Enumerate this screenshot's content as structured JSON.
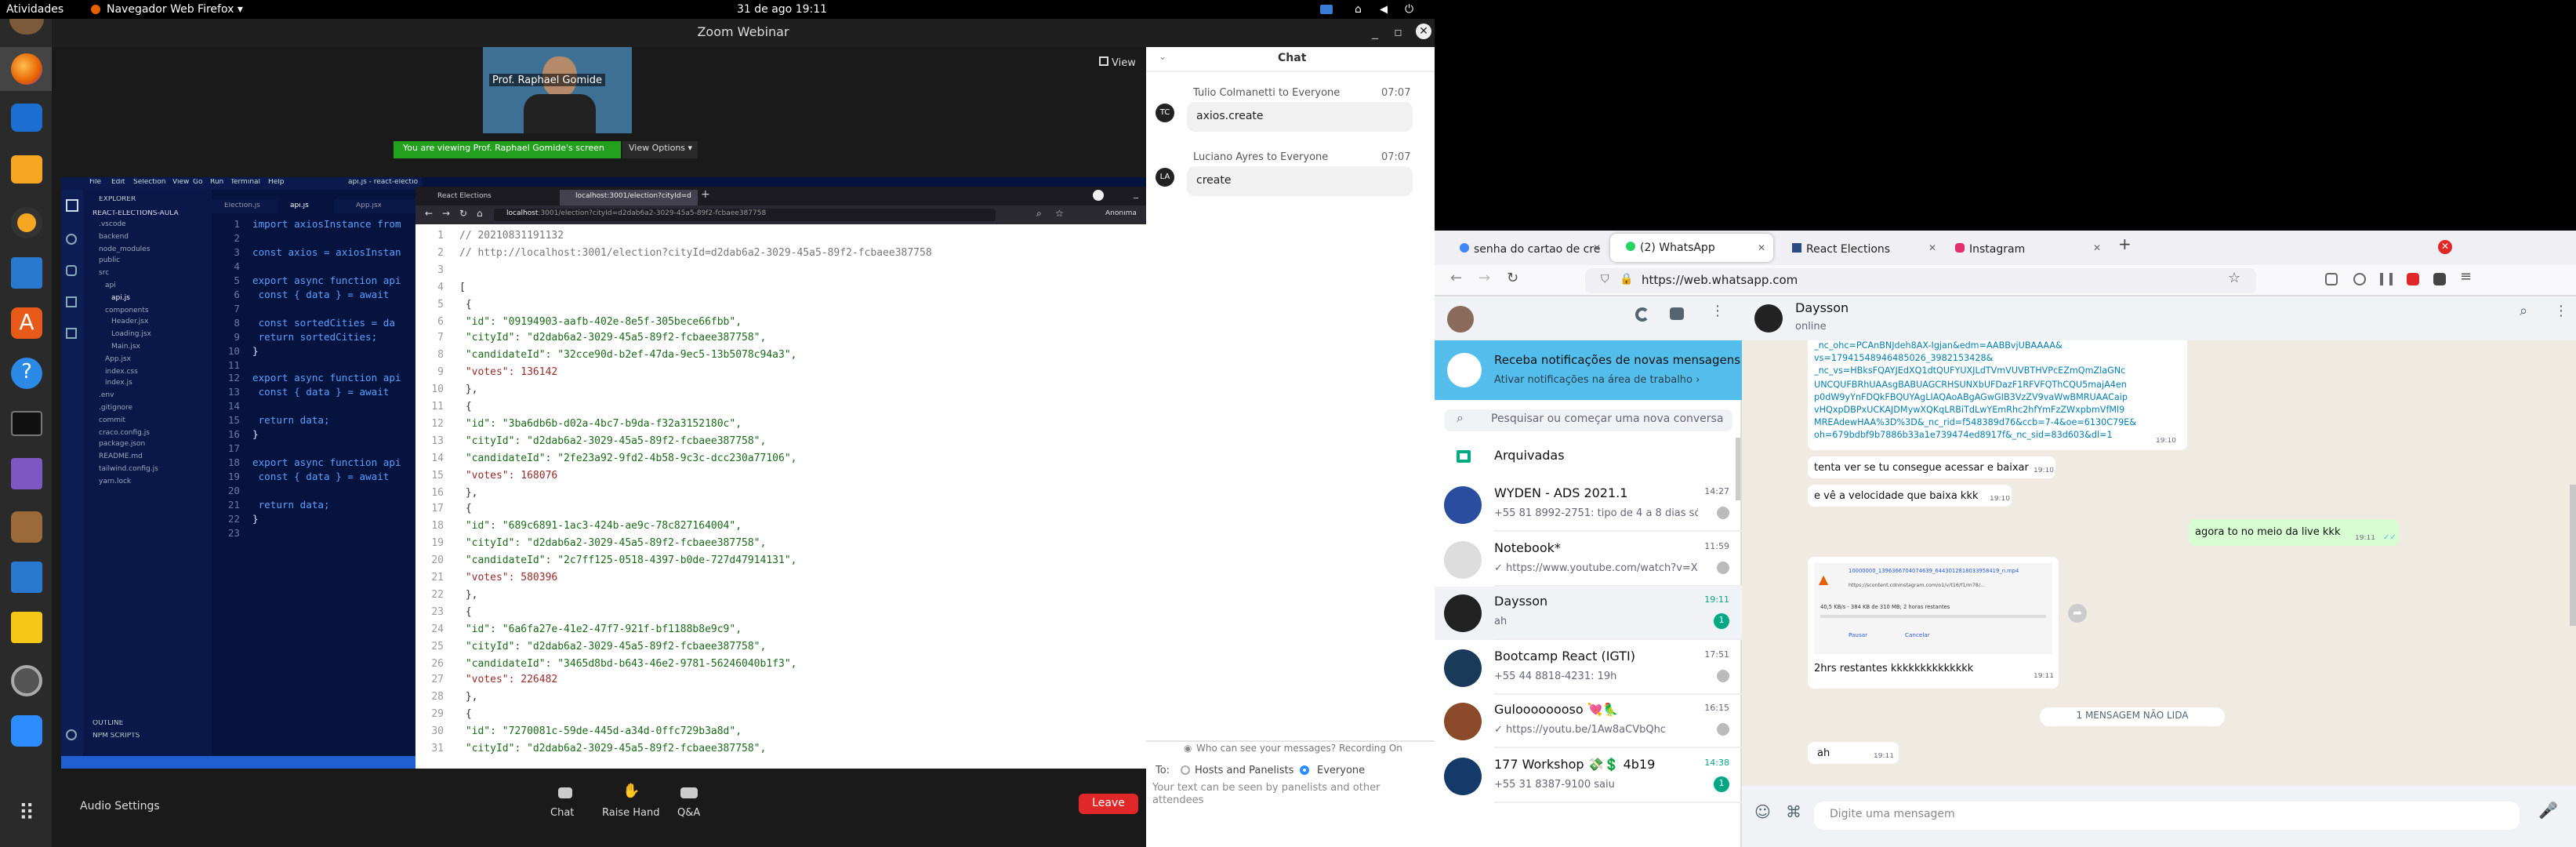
{
  "topbar": {
    "activities": "Atividades",
    "app": "Navegador Web Firefox ▾",
    "clock": "31 de ago  19:11"
  },
  "zoom": {
    "title": "Zoom Webinar",
    "view_label": "View",
    "speaker_name": "Prof. Raphael Gomide",
    "viewing_banner": "You are viewing Prof. Raphael Gomide's screen",
    "view_options": "View Options ▾",
    "audio_settings": "Audio Settings",
    "chat_btn": "Chat",
    "raise_hand_btn": "Raise Hand",
    "qa_btn": "Q&A",
    "leave_btn": "Leave"
  },
  "chat": {
    "title": "Chat",
    "messages": [
      {
        "avatar": "TC",
        "from": "Tulio Colmanetti to Everyone",
        "time": "07:07",
        "text": "axios.create"
      },
      {
        "avatar": "LA",
        "from": "Luciano Ayres to Everyone",
        "time": "07:07",
        "text": "create"
      }
    ],
    "who_can_see": "Who can see your messages? Recording On",
    "to_label": "To:",
    "opt_hosts": "Hosts and Panelists",
    "opt_everyone": "Everyone",
    "placeholder": "Your text can be seen by panelists and other attendees"
  },
  "vscode": {
    "menu": [
      "File",
      "Edit",
      "Selection",
      "View",
      "Go",
      "Run",
      "Terminal",
      "Help"
    ],
    "title": "api.js - react-electio",
    "tabs": [
      "Election.js",
      "api.js",
      "App.jsx"
    ],
    "explorer_title": "EXPLORER",
    "project": "REACT-ELECTIONS-AULA",
    "tree": [
      ".vscode",
      "backend",
      "node_modules",
      "public",
      "src",
      "api",
      "api.js",
      "components",
      "Header.jsx",
      "Loading.jsx",
      "Main.jsx",
      "App.jsx",
      "index.css",
      "index.js",
      ".env",
      ".gitignore",
      "commit",
      "craco.config.js",
      "package.json",
      "README.md",
      "tailwind.config.js",
      "yarn.lock"
    ],
    "outline": "OUTLINE",
    "npm_scripts": "NPM SCRIPTS",
    "code_lines": [
      "import axiosInstance from",
      "",
      "const axios = axiosInstan",
      "",
      "export async function api",
      "  const { data } = await",
      "",
      "  const sortedCities = da",
      "  return sortedCities;",
      "}",
      "",
      "export async function api",
      "  const { data } = await",
      "",
      "  return data;",
      "}",
      "",
      "export async function api",
      "  const { data } = await",
      "",
      "  return data;",
      "}",
      ""
    ]
  },
  "browser_left": {
    "tabs": [
      "React Elections",
      "localhost:3001/election?cityId=d"
    ],
    "url_host": "localhost",
    "url_rest": ":3001/election?cityId=d2dab6a2-3029-45a5-89f2-fcbaee387758",
    "profile": "Anônima",
    "json_lines": [
      "// 20210831191132",
      "// http://localhost:3001/election?cityId=d2dab6a2-3029-45a5-89f2-fcbaee387758",
      "",
      "[",
      "  {",
      "    \"id\": \"09194903-aafb-402e-8e5f-305bece66fbb\",",
      "    \"cityId\": \"d2dab6a2-3029-45a5-89f2-fcbaee387758\",",
      "    \"candidateId\": \"32cce90d-b2ef-47da-9ec5-13b5078c94a3\",",
      "    \"votes\": 136142",
      "  },",
      "  {",
      "    \"id\": \"3ba6db6b-d02a-4bc7-b9da-f32a3152180c\",",
      "    \"cityId\": \"d2dab6a2-3029-45a5-89f2-fcbaee387758\",",
      "    \"candidateId\": \"2fe23a92-9fd2-4b58-9c3c-dcc230a77106\",",
      "    \"votes\": 168076",
      "  },",
      "  {",
      "    \"id\": \"689c6891-1ac3-424b-ae9c-78c827164004\",",
      "    \"cityId\": \"d2dab6a2-3029-45a5-89f2-fcbaee387758\",",
      "    \"candidateId\": \"2c7ff125-0518-4397-b0de-727d47914131\",",
      "    \"votes\": 580396",
      "  },",
      "  {",
      "    \"id\": \"6a6fa27e-41e2-47f7-921f-bf1188b8e9c9\",",
      "    \"cityId\": \"d2dab6a2-3029-45a5-89f2-fcbaee387758\",",
      "    \"candidateId\": \"3465d8bd-b643-46e2-9781-56246040b1f3\",",
      "    \"votes\": 226482",
      "  },",
      "  {",
      "    \"id\": \"7270081c-59de-445d-a34d-0ffc729b3a8d\",",
      "    \"cityId\": \"d2dab6a2-3029-45a5-89f2-fcbaee387758\","
    ]
  },
  "firefox": {
    "tabs": [
      "senha do cartao de credi",
      "(2) WhatsApp",
      "React Elections",
      "Instagram"
    ],
    "url": "https://web.whatsapp.com"
  },
  "whatsapp": {
    "notif_title": "Receba notificações de novas mensagens",
    "notif_sub": "Ativar notificações na área de trabalho ›",
    "search_placeholder": "Pesquisar ou começar uma nova conversa",
    "archived": "Arquivadas",
    "chats": [
      {
        "name": "WYDEN - ADS 2021.1",
        "time": "14:27",
        "preview": "+55 81 8992-2751: tipo de 4 a 8 dias só par..."
      },
      {
        "name": "Notebook*",
        "time": "11:59",
        "preview": "✓ https://www.youtube.com/watch?v=Ximm..."
      },
      {
        "name": "Daysson",
        "time": "19:11",
        "preview": "ah",
        "badge": "1"
      },
      {
        "name": "Bootcamp React (IGTI)",
        "time": "17:51",
        "preview": "+55 44 8818-4231: 19h"
      },
      {
        "name": "Guloooooooso 💘🦜",
        "time": "16:15",
        "preview": "✓ https://youtu.be/1Aw8aCVbQhc"
      },
      {
        "name": "177 Workshop 💸💲 4b19",
        "time": "14:38",
        "preview": "+55 31 8387-9100 saiu",
        "badge": "1"
      }
    ],
    "contact": "Daysson",
    "status": "online",
    "link_lines": [
      "_nc_ohc=PCAnBNJdeh8AX-Igjan&edm=AABBvjUBAAAA&",
      "vs=17941548946485026_3982153428&",
      "_nc_vs=HBksFQAYJEdXQ1dtQUFYUXJLdTVmVUVBTHVPcEZmQmZlaGNc",
      "UNCQUFBRhUAAsgBABUAGCRHSUNXbUFDazF1RFVFQThCQU5majA4en",
      "p0dW9yYnFDQkFBQUYAgLIAQAoABgAGwGIB3VzZV9vaWwBMRUAACaip",
      "vHQxpDBPxUCKAJDMywXQKqLRBiTdLwYEmRhc2hfYmFzZWxpbmVfMl9",
      "MREAdewHAA%3D%3D&_nc_rid=f548389d76&ccb=7-4&oe=6130C79E&",
      "oh=679bdbf9b7886b33a1e739474ed8917f&_nc_sid=83d603&dl=1"
    ],
    "link_time": "19:10",
    "msgs": [
      {
        "text": "tenta ver se tu consegue acessar e baixar",
        "time": "19:10"
      },
      {
        "text": "e vê a velocidade que baixa kkk",
        "time": "19:10"
      }
    ],
    "sent": {
      "text": "agora to no meio da live kkk",
      "time": "19:11"
    },
    "download": {
      "filename": "10000000_1396366704074639_6443012818033958419_n.mp4",
      "url": "https://scontent.cdninstagram.com/o1/v/t16/f1/m78/...",
      "progress": "40,5 KB/s - 384 KB de 310 MB; 2 horas restantes",
      "pause": "Pausar",
      "cancel": "Cancelar"
    },
    "dl_msg": {
      "text": "2hrs restantes kkkkkkkkkkkkkk",
      "time": "19:11"
    },
    "unread": "1 MENSAGEM NÃO LIDA",
    "last": {
      "text": "ah",
      "time": "19:11"
    },
    "compose_placeholder": "Digite uma mensagem"
  },
  "colors": {
    "zoom_green": "#23a01e",
    "leave_red": "#e02828",
    "wa_green": "#00a884",
    "wa_bg": "#efeae2",
    "sent_bubble": "#d9fdd3",
    "vscode_bg": "#07133f",
    "json_string": "#1a6a1a",
    "json_number": "#9a2a2a"
  }
}
